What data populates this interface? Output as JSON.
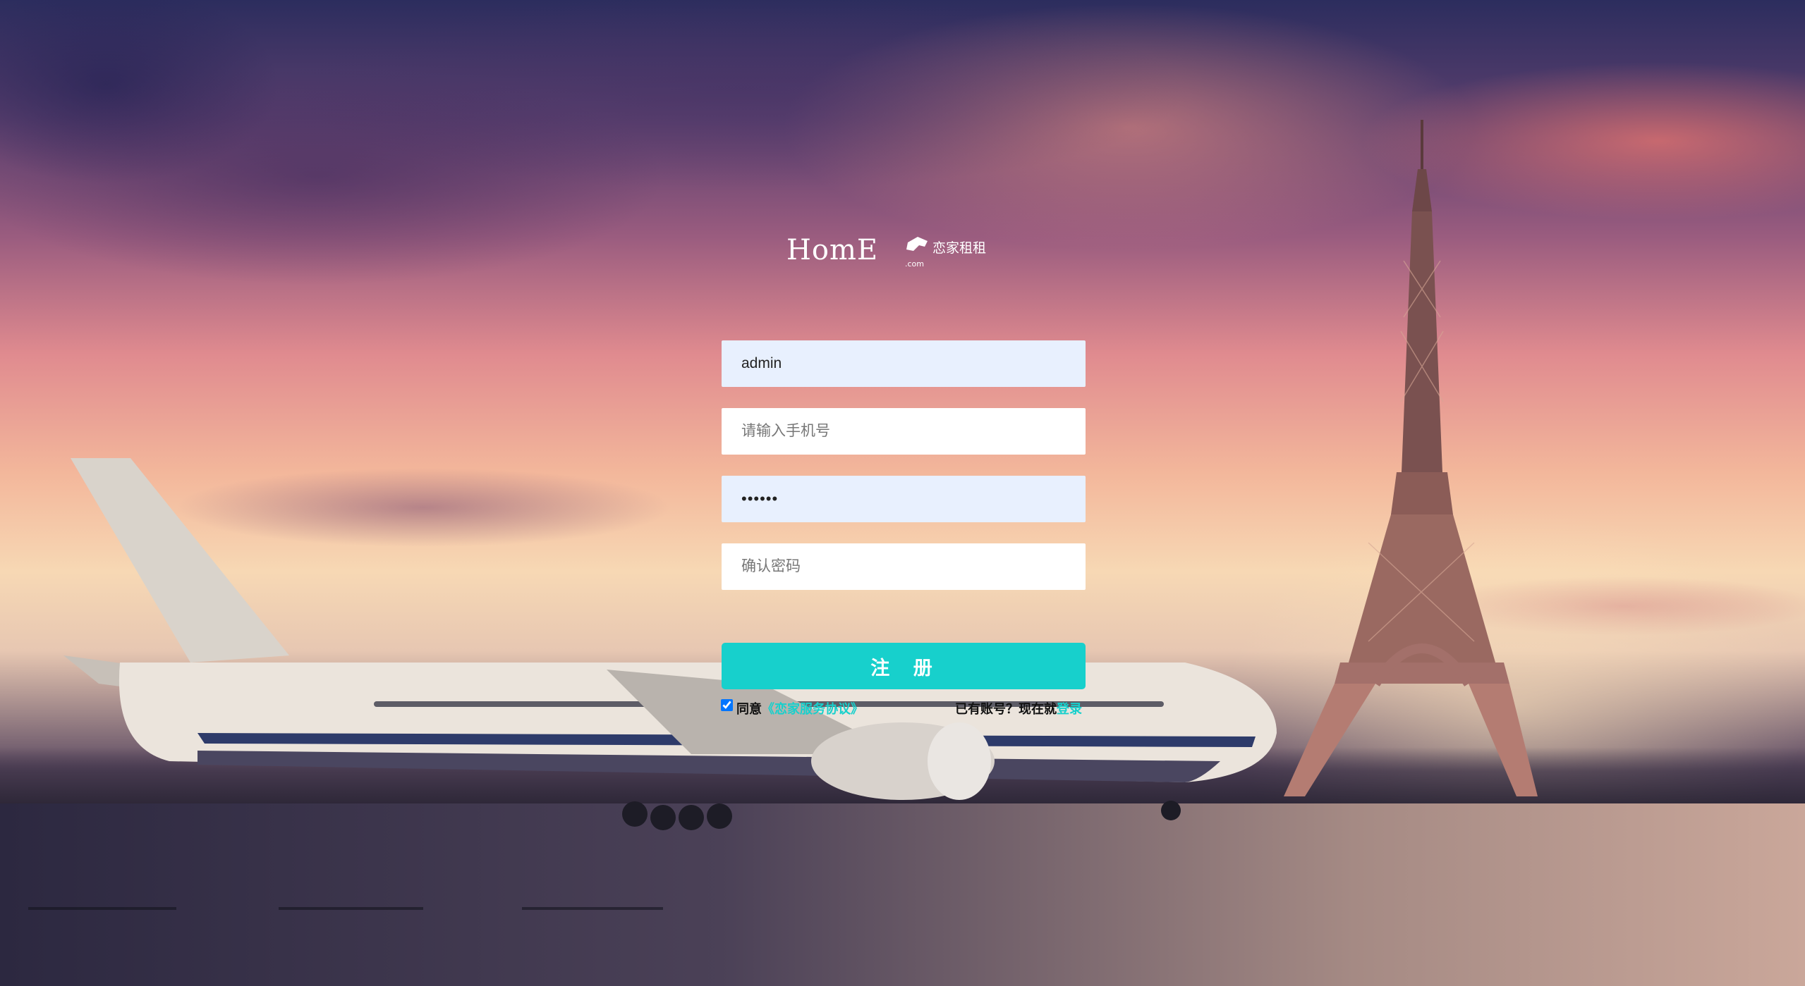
{
  "logo": {
    "wordmark": "HomE",
    "chinese": "恋家租租",
    "domain": ".com"
  },
  "form": {
    "username_value": "admin",
    "phone_placeholder": "请输入手机号",
    "password_value": "••••••",
    "confirm_placeholder": "确认密码",
    "submit_label": "注 册"
  },
  "agreement": {
    "checked": true,
    "prefix": "同意",
    "link": "《恋家服务协议》",
    "have_account": "已有账号？现在就",
    "login_link": "登录"
  },
  "colors": {
    "accent": "#17d0cc",
    "autofill": "#e8f0fe"
  }
}
